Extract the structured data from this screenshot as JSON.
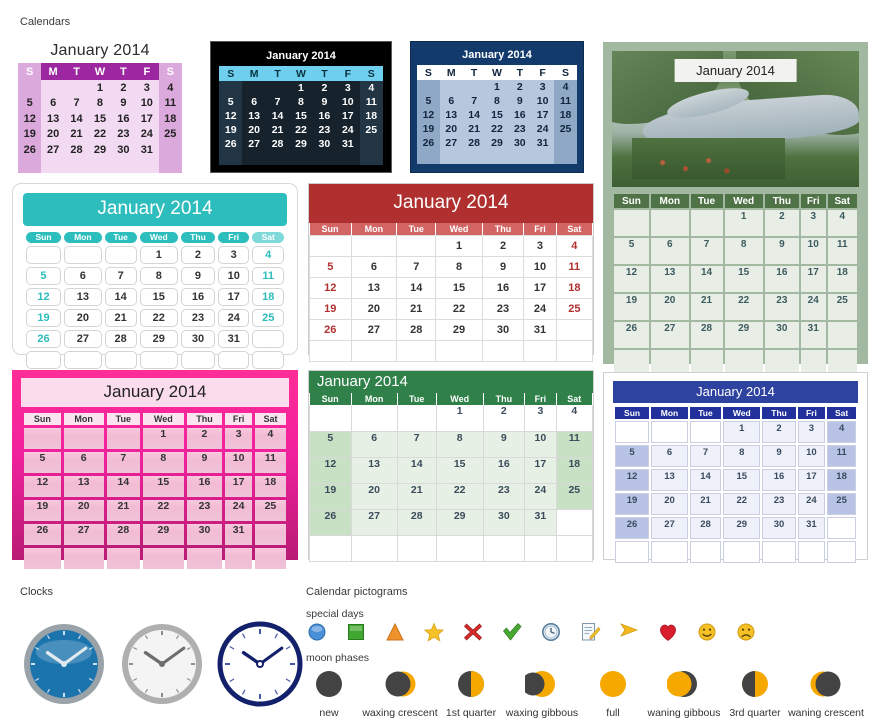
{
  "labels": {
    "calendars": "Calendars",
    "clocks": "Clocks",
    "pictograms": "Calendar pictograms",
    "special_days": "special days",
    "moon_phases": "moon phases"
  },
  "month_title": "January 2014",
  "weekday_short": [
    "S",
    "M",
    "T",
    "W",
    "T",
    "F",
    "S"
  ],
  "weekday_abbr": [
    "Sun",
    "Mon",
    "Tue",
    "Wed",
    "Thu",
    "Fri",
    "Sat"
  ],
  "grid": [
    [
      "",
      "",
      "",
      "1",
      "2",
      "3",
      "4"
    ],
    [
      "5",
      "6",
      "7",
      "8",
      "9",
      "10",
      "11"
    ],
    [
      "12",
      "13",
      "14",
      "15",
      "16",
      "17",
      "18"
    ],
    [
      "19",
      "20",
      "21",
      "22",
      "23",
      "24",
      "25"
    ],
    [
      "26",
      "27",
      "28",
      "29",
      "30",
      "31",
      ""
    ],
    [
      "",
      "",
      "",
      "",
      "",
      "",
      ""
    ]
  ],
  "calendars": [
    {
      "id": "purple",
      "name": "purple-calendar",
      "accent": "#9C27A0",
      "body": "#F2DBF2",
      "weekend": "#DCA9DC"
    },
    {
      "id": "dark",
      "name": "dark-calendar",
      "accent": "#6FCFEF",
      "body": "#16222C",
      "weekend": "#223544"
    },
    {
      "id": "navy",
      "name": "navy-calendar",
      "accent": "#123B6B",
      "body": "#B6C8DE",
      "weekend": "#8FA8C6"
    },
    {
      "id": "photo",
      "name": "photo-calendar",
      "accent": "#4F7247",
      "body": "#E8EDE6",
      "weekend": "#A3B8A0"
    },
    {
      "id": "teal",
      "name": "teal-calendar",
      "accent": "#2EBDBD",
      "body": "#FFFFFF",
      "weekend": "#7FD9D9"
    },
    {
      "id": "red",
      "name": "red-calendar",
      "accent": "#B0302F",
      "body": "#FFFFFF",
      "weekend": "#D26464"
    },
    {
      "id": "pink",
      "name": "pink-calendar",
      "accent": "#FF2D96",
      "body": "#F2BBD4",
      "weekend": "#FBE3EF"
    },
    {
      "id": "green",
      "name": "green-calendar",
      "accent": "#2F8049",
      "body": "#E6F0E4",
      "weekend": "#C8E0C4"
    },
    {
      "id": "blue",
      "name": "blue-calendar",
      "accent": "#2E43A0",
      "body": "#EEF1FA",
      "weekend": "#B8C3E6"
    }
  ],
  "clocks": [
    {
      "name": "blue-wall-clock",
      "face": "#1C74AD",
      "bezel": "#9AA3A8",
      "hour": 10,
      "minute": 9
    },
    {
      "name": "white-wall-clock",
      "face": "#F4F4F4",
      "bezel": "#AFAFAF",
      "hour": 10,
      "minute": 9
    },
    {
      "name": "navy-outline-clock",
      "face": "#FFFFFF",
      "bezel": "#13206B",
      "hour": 10,
      "minute": 9
    }
  ],
  "special_days": [
    {
      "icon": "blue-circle-icon",
      "label": "blue circle",
      "color": "#4A90D9"
    },
    {
      "icon": "green-square-icon",
      "label": "green square",
      "color": "#3FA72F"
    },
    {
      "icon": "orange-triangle-icon",
      "label": "orange triangle",
      "color": "#F0922B"
    },
    {
      "icon": "gold-star-icon",
      "label": "gold star",
      "color": "#F5C127"
    },
    {
      "icon": "red-cross-icon",
      "label": "red cross",
      "color": "#D42B2B"
    },
    {
      "icon": "green-check-icon",
      "label": "green check",
      "color": "#49A832"
    },
    {
      "icon": "clock-icon",
      "label": "clock",
      "color": "#6F93B8"
    },
    {
      "icon": "note-pencil-icon",
      "label": "note with pencil",
      "color": "#8FA8C0"
    },
    {
      "icon": "yellow-flag-icon",
      "label": "yellow flag",
      "color": "#F5B81E"
    },
    {
      "icon": "red-heart-icon",
      "label": "red heart",
      "color": "#D81E2C"
    },
    {
      "icon": "smiley-happy-icon",
      "label": "happy face",
      "color": "#F5C127"
    },
    {
      "icon": "smiley-sad-icon",
      "label": "sad face",
      "color": "#F5C127"
    }
  ],
  "moon_phases": [
    {
      "name": "moon-new",
      "label": "new",
      "lit": 0.0
    },
    {
      "name": "moon-waxing-crescent",
      "label": "waxing crescent",
      "lit": 0.25
    },
    {
      "name": "moon-first-quarter",
      "label": "1st quarter",
      "lit": 0.5
    },
    {
      "name": "moon-waxing-gibbous",
      "label": "waxing gibbous",
      "lit": 0.75
    },
    {
      "name": "moon-full",
      "label": "full",
      "lit": 1.0
    },
    {
      "name": "moon-waning-gibbous",
      "label": "waning gibbous",
      "lit": 0.75
    },
    {
      "name": "moon-third-quarter",
      "label": "3rd quarter",
      "lit": 0.5
    },
    {
      "name": "moon-waning-crescent",
      "label": "waning crescent",
      "lit": 0.25
    }
  ],
  "moon_colors": {
    "lit": "#F5A800",
    "dark": "#434343"
  }
}
